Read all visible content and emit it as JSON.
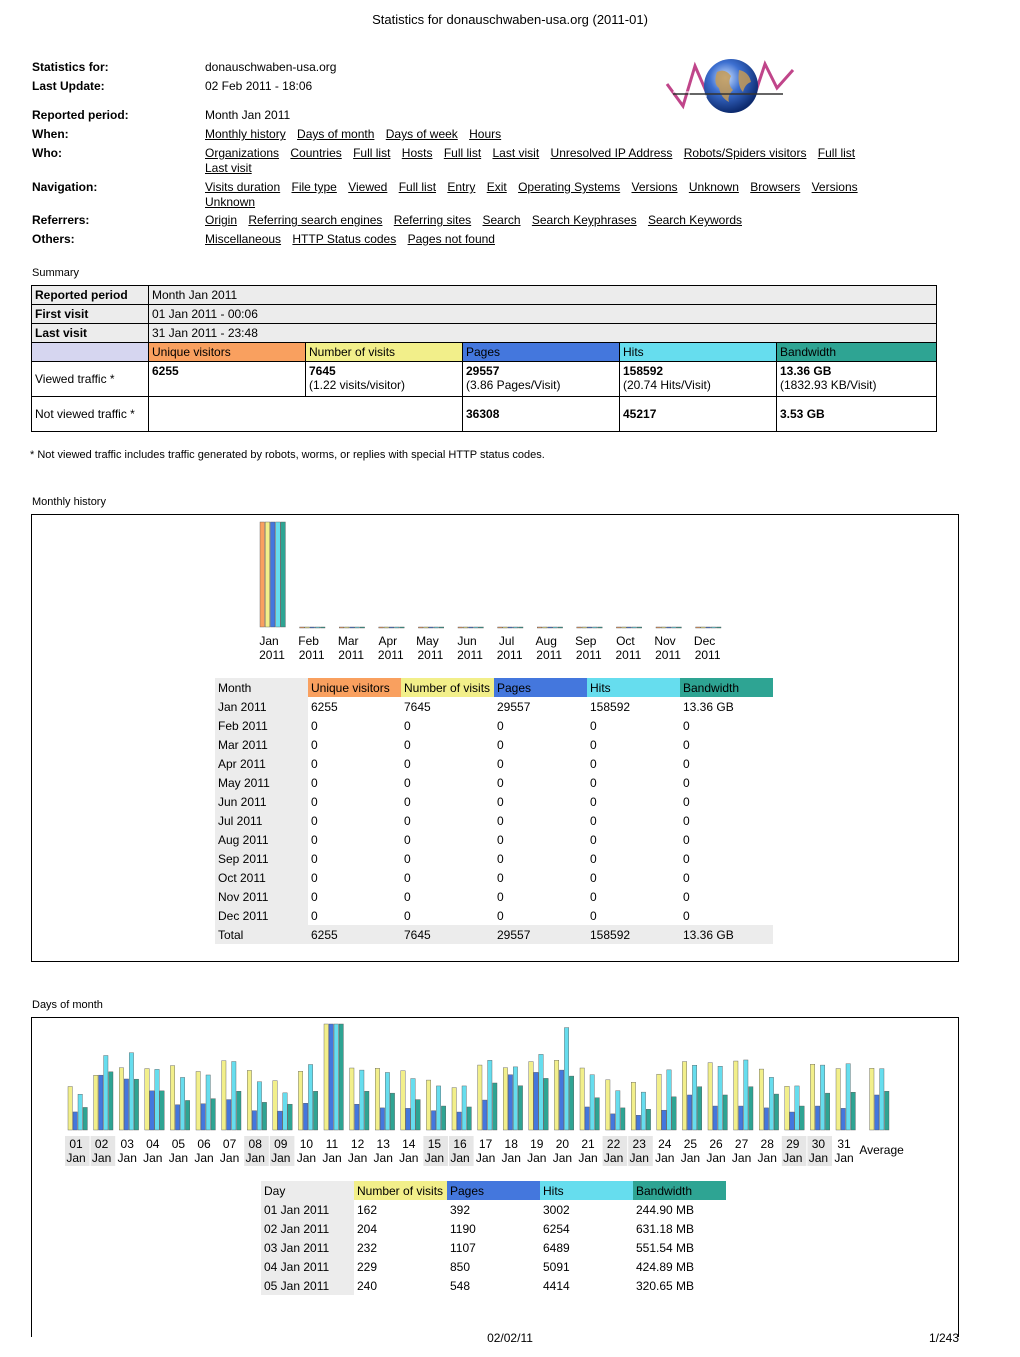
{
  "title": "Statistics for donauschwaben-usa.org (2011-01)",
  "info": {
    "stats_for_label": "Statistics for:",
    "stats_for_value": "donauschwaben-usa.org",
    "last_update_label": "Last Update:",
    "last_update_value": "02 Feb 2011 - 18:06",
    "period_label": "Reported period:",
    "period_value": "Month Jan 2011",
    "when_label": "When:",
    "who_label": "Who:",
    "nav_label": "Navigation:",
    "ref_label": "Referrers:",
    "others_label": "Others:"
  },
  "links": {
    "when": [
      "Monthly history",
      "Days of month",
      "Days of week",
      "Hours"
    ],
    "who": [
      "Organizations",
      "Countries",
      "Full list",
      "Hosts",
      "Full list",
      "Last visit",
      "Unresolved IP Address",
      "Robots/Spiders visitors",
      "Full list",
      "Last visit"
    ],
    "navigation": [
      "Visits duration",
      "File type",
      "Viewed",
      "Full list",
      "Entry",
      "Exit",
      "Operating Systems",
      "Versions",
      "Unknown",
      "Browsers",
      "Versions",
      "Unknown"
    ],
    "referrers": [
      "Origin",
      "Referring search engines",
      "Referring sites",
      "Search",
      "Search Keyphrases",
      "Search Keywords"
    ],
    "others": [
      "Miscellaneous",
      "HTTP Status codes",
      "Pages not found"
    ]
  },
  "summary": {
    "label": "Summary",
    "reported_period_label": "Reported period",
    "reported_period_value": "Month Jan 2011",
    "first_visit_label": "First visit",
    "first_visit_value": "01 Jan 2011 - 00:06",
    "last_visit_label": "Last visit",
    "last_visit_value": "31 Jan 2011 - 23:48",
    "headers": [
      "Unique visitors",
      "Number of visits",
      "Pages",
      "Hits",
      "Bandwidth"
    ],
    "viewed_label": "Viewed traffic *",
    "viewed": [
      "6255",
      "7645",
      "29557",
      "158592",
      "13.36 GB"
    ],
    "viewed_sub": [
      "",
      "(1.22 visits/visitor)",
      "(3.86 Pages/Visit)",
      "(20.74 Hits/Visit)",
      "(1832.93 KB/Visit)"
    ],
    "not_viewed_label": "Not viewed traffic *",
    "not_viewed": [
      "",
      "",
      "36308",
      "45217",
      "3.53 GB"
    ],
    "footnote": "* Not viewed traffic includes traffic generated by robots, worms, or replies with special HTTP status codes."
  },
  "monthly": {
    "label": "Monthly history",
    "headers": [
      "Month",
      "Unique visitors",
      "Number of visits",
      "Pages",
      "Hits",
      "Bandwidth"
    ],
    "rows": [
      [
        "Jan 2011",
        "6255",
        "7645",
        "29557",
        "158592",
        "13.36 GB"
      ],
      [
        "Feb 2011",
        "0",
        "0",
        "0",
        "0",
        "0"
      ],
      [
        "Mar 2011",
        "0",
        "0",
        "0",
        "0",
        "0"
      ],
      [
        "Apr 2011",
        "0",
        "0",
        "0",
        "0",
        "0"
      ],
      [
        "May 2011",
        "0",
        "0",
        "0",
        "0",
        "0"
      ],
      [
        "Jun 2011",
        "0",
        "0",
        "0",
        "0",
        "0"
      ],
      [
        "Jul 2011",
        "0",
        "0",
        "0",
        "0",
        "0"
      ],
      [
        "Aug 2011",
        "0",
        "0",
        "0",
        "0",
        "0"
      ],
      [
        "Sep 2011",
        "0",
        "0",
        "0",
        "0",
        "0"
      ],
      [
        "Oct 2011",
        "0",
        "0",
        "0",
        "0",
        "0"
      ],
      [
        "Nov 2011",
        "0",
        "0",
        "0",
        "0",
        "0"
      ],
      [
        "Dec 2011",
        "0",
        "0",
        "0",
        "0",
        "0"
      ]
    ],
    "total": [
      "Total",
      "6255",
      "7645",
      "29557",
      "158592",
      "13.36 GB"
    ]
  },
  "days": {
    "label": "Days of month",
    "average_label": "Average",
    "headers": [
      "Day",
      "Number of visits",
      "Pages",
      "Hits",
      "Bandwidth"
    ],
    "rows": [
      [
        "01 Jan 2011",
        "162",
        "392",
        "3002",
        "244.90 MB"
      ],
      [
        "02 Jan 2011",
        "204",
        "1190",
        "6254",
        "631.18 MB"
      ],
      [
        "03 Jan 2011",
        "232",
        "1107",
        "6489",
        "551.54 MB"
      ],
      [
        "04 Jan 2011",
        "229",
        "850",
        "5091",
        "424.89 MB"
      ],
      [
        "05 Jan 2011",
        "240",
        "548",
        "4414",
        "320.65 MB"
      ]
    ]
  },
  "chart_data": [
    {
      "type": "bar",
      "categories": [
        "Jan 2011",
        "Feb 2011",
        "Mar 2011",
        "Apr 2011",
        "May 2011",
        "Jun 2011",
        "Jul 2011",
        "Aug 2011",
        "Sep 2011",
        "Oct 2011",
        "Nov 2011",
        "Dec 2011"
      ],
      "tick_labels_top": [
        "Jan",
        "Feb",
        "Mar",
        "Apr",
        "May",
        "Jun",
        "Jul",
        "Aug",
        "Sep",
        "Oct",
        "Nov",
        "Dec"
      ],
      "tick_labels_bottom": [
        "2011",
        "2011",
        "2011",
        "2011",
        "2011",
        "2011",
        "2011",
        "2011",
        "2011",
        "2011",
        "2011",
        "2011"
      ],
      "series": [
        {
          "name": "Unique visitors",
          "color": "#f9a05f",
          "values": [
            6255,
            0,
            0,
            0,
            0,
            0,
            0,
            0,
            0,
            0,
            0,
            0
          ]
        },
        {
          "name": "Number of visits",
          "color": "#f2ef8a",
          "values": [
            7645,
            0,
            0,
            0,
            0,
            0,
            0,
            0,
            0,
            0,
            0,
            0
          ]
        },
        {
          "name": "Pages",
          "color": "#4477dd",
          "values": [
            29557,
            0,
            0,
            0,
            0,
            0,
            0,
            0,
            0,
            0,
            0,
            0
          ]
        },
        {
          "name": "Hits",
          "color": "#66ddee",
          "values": [
            158592,
            0,
            0,
            0,
            0,
            0,
            0,
            0,
            0,
            0,
            0,
            0
          ]
        },
        {
          "name": "Bandwidth",
          "color": "#2ea493",
          "values": [
            13.36,
            0,
            0,
            0,
            0,
            0,
            0,
            0,
            0,
            0,
            0,
            0
          ]
        }
      ]
    },
    {
      "type": "bar",
      "tick_labels_top": [
        "01",
        "02",
        "03",
        "04",
        "05",
        "06",
        "07",
        "08",
        "09",
        "10",
        "11",
        "12",
        "13",
        "14",
        "15",
        "16",
        "17",
        "18",
        "19",
        "20",
        "21",
        "22",
        "23",
        "24",
        "25",
        "26",
        "27",
        "28",
        "29",
        "30",
        "31"
      ],
      "tick_labels_bottom": [
        "Jan",
        "Jan",
        "Jan",
        "Jan",
        "Jan",
        "Jan",
        "Jan",
        "Jan",
        "Jan",
        "Jan",
        "Jan",
        "Jan",
        "Jan",
        "Jan",
        "Jan",
        "Jan",
        "Jan",
        "Jan",
        "Jan",
        "Jan",
        "Jan",
        "Jan",
        "Jan",
        "Jan",
        "Jan",
        "Jan",
        "Jan",
        "Jan",
        "Jan",
        "Jan",
        "Jan"
      ],
      "weekend_days": [
        "01",
        "02",
        "08",
        "09",
        "15",
        "16",
        "22",
        "23",
        "29",
        "30"
      ],
      "series": [
        {
          "name": "Number of visits",
          "color": "#f2ef8a",
          "values": [
            162,
            204,
            232,
            229,
            240,
            218,
            258,
            222,
            184,
            219,
            395,
            231,
            230,
            221,
            186,
            158,
            242,
            232,
            255,
            260,
            231,
            187,
            178,
            208,
            255,
            251,
            257,
            227,
            163,
            245,
            229,
            230
          ]
        },
        {
          "name": "Pages",
          "color": "#4477dd",
          "values": [
            392,
            1190,
            1107,
            850,
            548,
            570,
            660,
            420,
            410,
            580,
            2300,
            560,
            480,
            470,
            420,
            390,
            650,
            1200,
            1250,
            1300,
            500,
            350,
            320,
            430,
            760,
            520,
            520,
            480,
            390,
            520,
            470,
            760
          ]
        },
        {
          "name": "Hits",
          "color": "#66ddee",
          "values": [
            3002,
            6254,
            6489,
            5091,
            4414,
            4620,
            5750,
            4050,
            3120,
            5500,
            8900,
            5030,
            4830,
            4320,
            3700,
            3700,
            5850,
            5300,
            6350,
            8600,
            4640,
            3300,
            3180,
            5050,
            5440,
            5350,
            5880,
            4420,
            3700,
            5450,
            5560,
            5150
          ]
        },
        {
          "name": "Bandwidth",
          "color": "#2ea493",
          "values": [
            244.9,
            631.18,
            551.54,
            424.89,
            320.65,
            340,
            420,
            300,
            280,
            420,
            1150,
            420,
            400,
            330,
            260,
            250,
            510,
            480,
            560,
            585,
            350,
            240,
            225,
            360,
            470,
            380,
            470,
            390,
            260,
            400,
            410,
            420
          ]
        }
      ]
    }
  ]
}
